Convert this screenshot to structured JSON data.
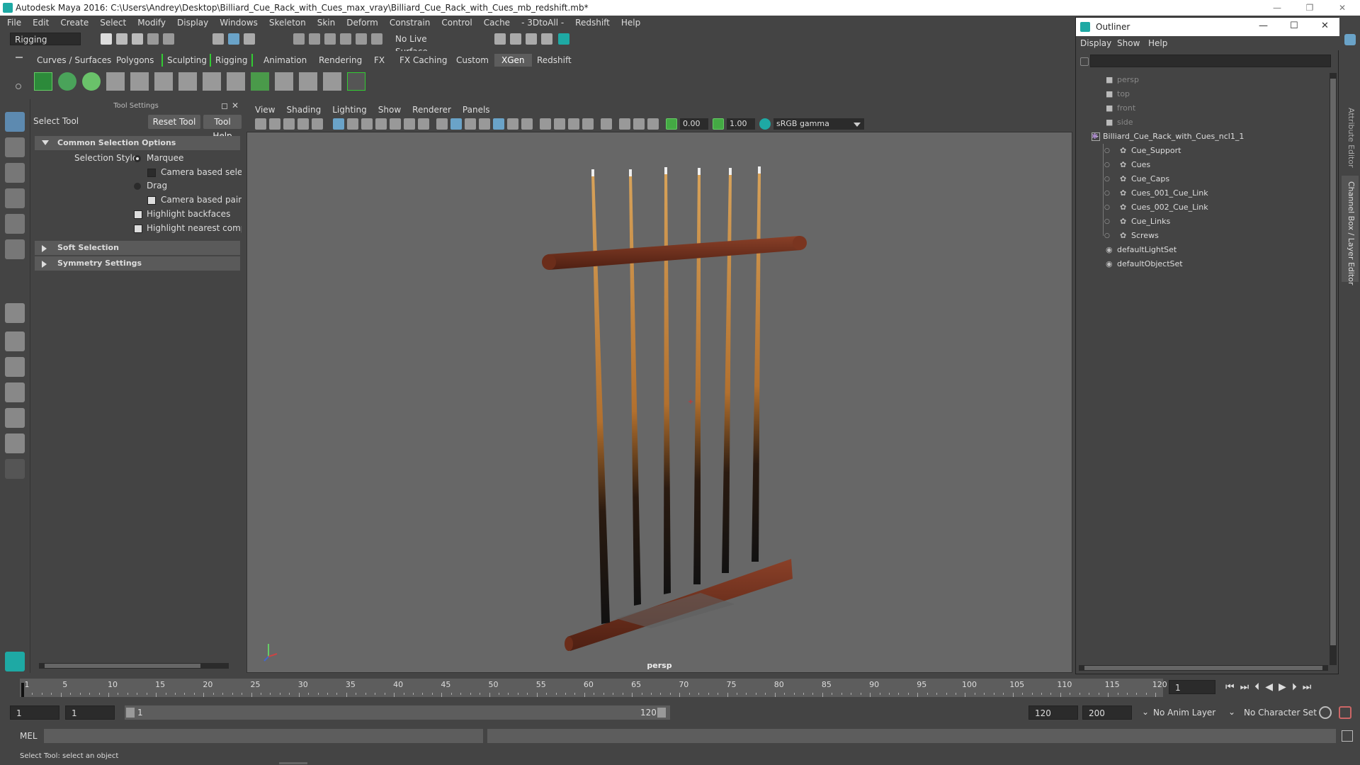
{
  "window": {
    "title": "Autodesk Maya 2016: C:\\Users\\Andrey\\Desktop\\Billiard_Cue_Rack_with_Cues_max_vray\\Billiard_Cue_Rack_with_Cues_mb_redshift.mb*",
    "minimize": "—",
    "restore": "❐",
    "close": "✕"
  },
  "menubar": [
    "File",
    "Edit",
    "Create",
    "Select",
    "Modify",
    "Display",
    "Windows",
    "Skeleton",
    "Skin",
    "Deform",
    "Constrain",
    "Control",
    "Cache",
    "- 3DtoAll -",
    "Redshift",
    "Help"
  ],
  "statusline": {
    "menuset": "Rigging",
    "live_surface": "No Live Surface"
  },
  "shelf_tabs": [
    {
      "label": "Curves / Surfaces",
      "active": false
    },
    {
      "label": "Polygons",
      "active": false
    },
    {
      "label": "Sculpting",
      "active": false
    },
    {
      "label": "Rigging",
      "active": false
    },
    {
      "label": "Animation",
      "active": false
    },
    {
      "label": "Rendering",
      "active": false
    },
    {
      "label": "FX",
      "active": false
    },
    {
      "label": "FX Caching",
      "active": false
    },
    {
      "label": "Custom",
      "active": false
    },
    {
      "label": "XGen",
      "active": true
    },
    {
      "label": "Redshift",
      "active": false
    }
  ],
  "tool_settings": {
    "header": "Tool Settings",
    "tool_name": "Select Tool",
    "reset_button": "Reset Tool",
    "help_button": "Tool Help",
    "common_section": "Common Selection Options",
    "selection_style_label": "Selection Style:",
    "marquee": "Marquee",
    "camera_based_selection": "Camera based selectio",
    "drag": "Drag",
    "camera_based_paint": "Camera based paint se",
    "highlight_backfaces": "Highlight backfaces",
    "highlight_nearest": "Highlight nearest compor",
    "soft_selection": "Soft Selection",
    "symmetry_settings": "Symmetry Settings"
  },
  "viewport": {
    "menu": [
      "View",
      "Shading",
      "Lighting",
      "Show",
      "Renderer",
      "Panels"
    ],
    "field_a": "0.00",
    "field_b": "1.00",
    "color_space": "sRGB gamma",
    "camera_label": "persp"
  },
  "outliner": {
    "title": "Outliner",
    "menu": [
      "Display",
      "Show",
      "Help"
    ],
    "items": [
      {
        "label": "persp",
        "indent": 1,
        "dim": true,
        "icon": "camera-icon"
      },
      {
        "label": "top",
        "indent": 1,
        "dim": true,
        "icon": "camera-icon"
      },
      {
        "label": "front",
        "indent": 1,
        "dim": true,
        "icon": "camera-icon"
      },
      {
        "label": "side",
        "indent": 1,
        "dim": true,
        "icon": "camera-icon"
      },
      {
        "label": "Billiard_Cue_Rack_with_Cues_ncl1_1",
        "indent": 0,
        "dim": false,
        "icon": "group-icon"
      },
      {
        "label": "Cue_Support",
        "indent": 2,
        "dim": false,
        "icon": "transform-icon"
      },
      {
        "label": "Cues",
        "indent": 2,
        "dim": false,
        "icon": "transform-icon"
      },
      {
        "label": "Cue_Caps",
        "indent": 2,
        "dim": false,
        "icon": "transform-icon"
      },
      {
        "label": "Cues_001_Cue_Link",
        "indent": 2,
        "dim": false,
        "icon": "transform-icon"
      },
      {
        "label": "Cues_002_Cue_Link",
        "indent": 2,
        "dim": false,
        "icon": "transform-icon"
      },
      {
        "label": "Cue_Links",
        "indent": 2,
        "dim": false,
        "icon": "transform-icon"
      },
      {
        "label": "Screws",
        "indent": 2,
        "dim": false,
        "icon": "transform-icon"
      },
      {
        "label": "defaultLightSet",
        "indent": 1,
        "dim": false,
        "icon": "set-icon"
      },
      {
        "label": "defaultObjectSet",
        "indent": 1,
        "dim": false,
        "icon": "set-icon"
      }
    ]
  },
  "right_strip": {
    "attribute_editor": "Attribute Editor",
    "channel_box": "Channel Box / Layer Editor"
  },
  "timeline": {
    "ticks": [
      1,
      5,
      10,
      15,
      20,
      25,
      30,
      35,
      40,
      45,
      50,
      55,
      60,
      65,
      70,
      75,
      80,
      85,
      90,
      95,
      100,
      105,
      110,
      115,
      120
    ],
    "current_frame": "1"
  },
  "range": {
    "start": "1",
    "playback_start": "1",
    "slider_start": "1",
    "slider_end": "120",
    "playback_end": "120",
    "end": "200",
    "anim_layer": "No Anim Layer",
    "char_set": "No Character Set"
  },
  "command_line": {
    "lang": "MEL"
  },
  "help_line": "Select Tool: select an object",
  "colors": {
    "accent": "#1ea9a4",
    "active_tab": "#5d5d5d",
    "wood": "#7a3a22",
    "cue_light": "#c98a3e"
  }
}
